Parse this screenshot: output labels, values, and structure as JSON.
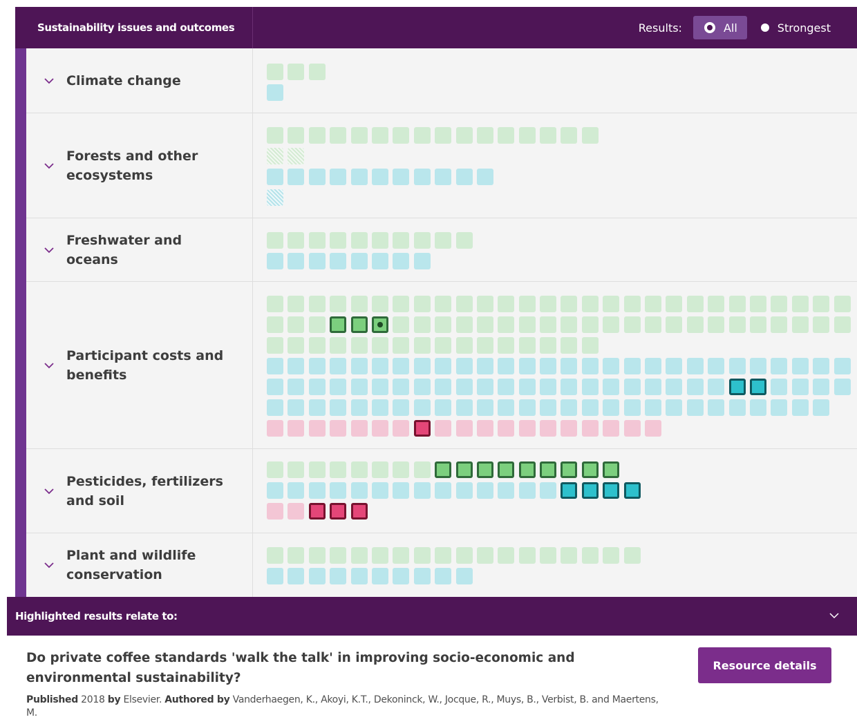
{
  "header": {
    "title": "Sustainability issues and outcomes",
    "results_label": "Results:",
    "options": [
      {
        "label": "All",
        "selected": true
      },
      {
        "label": "Strongest",
        "selected": false
      }
    ]
  },
  "legend_colors": {
    "green_faded": "#d1ebd2",
    "green_highlight": "#7ccf7e",
    "blue_faded": "#b9e6ec",
    "blue_highlight": "#2ec0cc",
    "pink_faded": "#f3c6d5",
    "pink_highlight": "#e44678",
    "accent": "#4e1556"
  },
  "issues": [
    {
      "label": "Climate change",
      "rows": [
        "ggg",
        "b"
      ]
    },
    {
      "label": "Forests and other ecosystems",
      "rows": [
        "gggggggggggggggg",
        "hh",
        "bbbbbbbbbbb",
        "k"
      ]
    },
    {
      "label": "Freshwater and oceans",
      "rows": [
        "gggggggggg",
        "bbbbbbbb"
      ]
    },
    {
      "label": "Participant costs and benefits",
      "rows": [
        "gggggggggggggggggggggggggggg",
        "gggGGDgggggggggggggggggggggg",
        "gggggggggggggggg",
        "bbbbbbbbbbbbbbbbbbbbbbbbbbbb",
        "bbbbbbbbbbbbbbbbbbbbbbBBbbbb",
        "bbbbbbbbbbbbbbbbbbbbbbbbbbb",
        "pppppppPppppppppppp"
      ]
    },
    {
      "label": "Pesticides, fertilizers and soil",
      "rows": [
        "ggggggggGGGGGGGGG",
        "bbbbbbbbbbbbbbBBBB",
        "ppPPP"
      ]
    },
    {
      "label": "Plant and wildlife conservation",
      "rows": [
        "gggggggggggggggggg",
        "bbbbbbbbbb"
      ]
    }
  ],
  "footer": {
    "highlight_title": "Highlighted results relate to:",
    "resource_title": "Do private coffee standards 'walk the talk' in improving socio-economic and environmental sustainability?",
    "resource_button": "Resource details",
    "published_label": "Published",
    "published_value": "2018",
    "by_label": "by",
    "publisher": "Elsevier.",
    "authored_label": "Authored by",
    "authors": "Vanderhaegen, K., Akoyi, K.T., Dekoninck, W., Jocque, R., Muys, B., Verbist, B. and Maertens, M."
  }
}
